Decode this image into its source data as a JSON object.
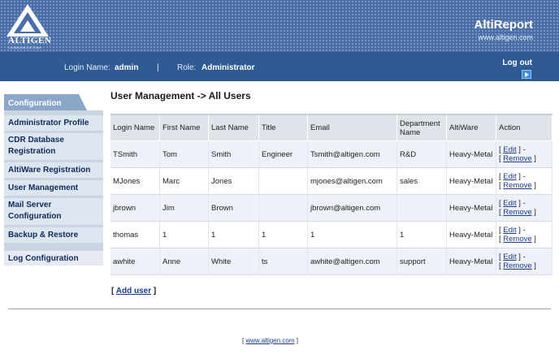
{
  "brand": {
    "logo_text": "ALTIGEN",
    "logo_sub": "COMMUNICATIONS",
    "title": "AltiReport",
    "url": "www.altigen.com"
  },
  "userbar": {
    "login_label": "Login Name:",
    "login_value": "admin",
    "separator": "|",
    "role_label": "Role:",
    "role_value": "Administrator",
    "logout_label": "Log out"
  },
  "sidebar": {
    "tab": "Configuration",
    "items": [
      {
        "label": "Administrator Profile"
      },
      {
        "label": "CDR Database Registration"
      },
      {
        "label": "AltiWare Registration"
      },
      {
        "label": "User Management"
      },
      {
        "label": "Mail Server Configuration"
      },
      {
        "label": "Backup & Restore"
      },
      {
        "label": "Log Configuration"
      }
    ]
  },
  "main": {
    "page_title": "User Management -> All Users",
    "columns": [
      "Login Name",
      "First Name",
      "Last Name",
      "Title",
      "Email",
      "Department Name",
      "AltiWare",
      "Action"
    ],
    "rows": [
      {
        "login": "TSmith",
        "first": "Tom",
        "last": "Smith",
        "title": "Engineer",
        "email": "Tsmith@altigen.com",
        "dept": "R&D",
        "altiware": "Heavy-Metal"
      },
      {
        "login": "MJones",
        "first": "Marc",
        "last": "Jones",
        "title": "",
        "email": "mjones@altigen.com",
        "dept": "sales",
        "altiware": "Heavy-Metal"
      },
      {
        "login": "jbrown",
        "first": "Jim",
        "last": "Brown",
        "title": "",
        "email": "jbrown@altigen.com",
        "dept": "",
        "altiware": "Heavy-Metal"
      },
      {
        "login": "thomas",
        "first": "1",
        "last": "1",
        "title": "1",
        "email": "1",
        "dept": "1",
        "altiware": "Heavy-Metal"
      },
      {
        "login": "awhite",
        "first": "Anne",
        "last": "White",
        "title": "ts",
        "email": "awhite@altigen.com",
        "dept": "support",
        "altiware": "Heavy-Metal"
      }
    ],
    "action_edit": "Edit",
    "action_remove": "Remove",
    "add_user": "Add user"
  },
  "footer": {
    "link": "www.altigen.com"
  },
  "colors": {
    "header_bg": "#4a6fa8",
    "userbar_bg": "#2f5a93",
    "sidebar_tab": "#8aa6c8",
    "link": "#1a3c8c"
  }
}
